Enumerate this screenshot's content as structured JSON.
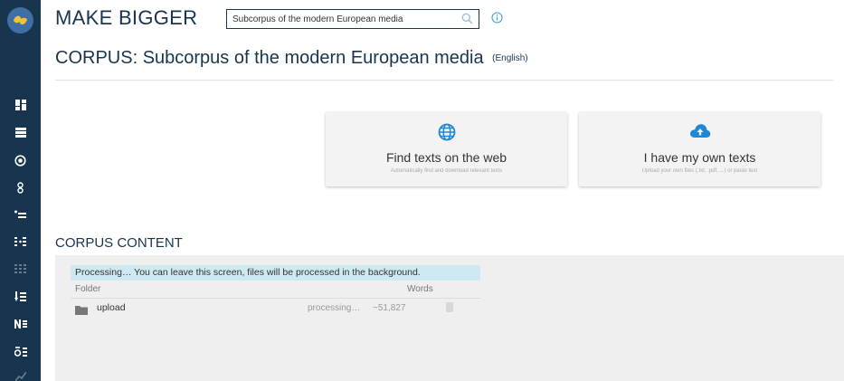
{
  "app": {
    "brand": "MAKE BIGGER",
    "accent": "#17354f"
  },
  "search": {
    "value": "Subcorpus of the modern European media",
    "placeholder": ""
  },
  "corpus": {
    "label": "CORPUS:",
    "name": "Subcorpus of the modern European media",
    "language": "(English)"
  },
  "sidebar": {
    "items": [
      {
        "icon": "dashboard-icon"
      },
      {
        "icon": "list-icon"
      },
      {
        "icon": "radio-target-icon"
      },
      {
        "icon": "ngram-icon"
      },
      {
        "icon": "bullet-list-icon"
      },
      {
        "icon": "columns-icon"
      },
      {
        "icon": "grid-list-icon"
      },
      {
        "icon": "sort-list-icon"
      },
      {
        "icon": "n-list-icon"
      },
      {
        "icon": "delta-list-icon"
      },
      {
        "icon": "chart-icon"
      }
    ]
  },
  "cards": [
    {
      "title": "Find texts on the web",
      "subtitle": "Automatically find and download relevant texts",
      "icon": "globe-icon"
    },
    {
      "title": "I have my own texts",
      "subtitle": "Upload your own files (.txt, .pdf, ...) or paste text",
      "icon": "cloud-upload-icon"
    }
  ],
  "content": {
    "title": "CORPUS CONTENT",
    "notice": "Processing… You can leave this screen, files will be processed in the background.",
    "columns": {
      "folder": "Folder",
      "words": "Words"
    },
    "rows": [
      {
        "name": "upload",
        "status": "processing…",
        "words": "~51,827"
      }
    ]
  }
}
